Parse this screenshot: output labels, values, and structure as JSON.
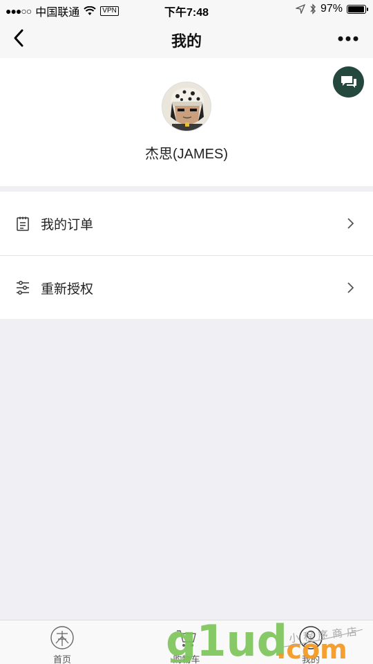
{
  "status": {
    "carrier": "中国联通",
    "vpn": "VPN",
    "time": "下午7:48",
    "battery": "97%",
    "battery_level": 0.97
  },
  "nav": {
    "title": "我的"
  },
  "profile": {
    "name": "杰思(JAMES)"
  },
  "menu": [
    {
      "label": "我的订单",
      "icon": "clipboard-icon"
    },
    {
      "label": "重新授权",
      "icon": "sliders-icon"
    }
  ],
  "tabs": [
    {
      "label": "首页",
      "icon": "home-logo-icon"
    },
    {
      "label": "购物车",
      "icon": "cart-icon"
    },
    {
      "label": "我的",
      "icon": "user-icon"
    }
  ],
  "watermark": {
    "text": "g1ud",
    "suffix": ".com",
    "tagline": "小程序商店"
  },
  "colors": {
    "chat_button": "#24483d",
    "watermark_green": "#7dc35a",
    "watermark_orange": "#f39a24",
    "background": "#efeff4"
  }
}
